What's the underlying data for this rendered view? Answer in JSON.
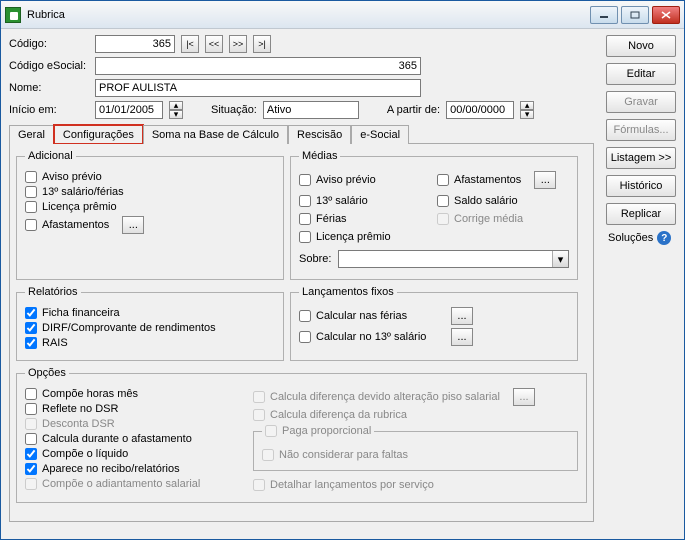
{
  "window": {
    "title": "Rubrica"
  },
  "buttons": {
    "novo": "Novo",
    "editar": "Editar",
    "gravar": "Gravar",
    "formulas": "Fórmulas...",
    "listagem": "Listagem >>",
    "historico": "Histórico",
    "replicar": "Replicar",
    "solucoes": "Soluções"
  },
  "form": {
    "codigo_label": "Código:",
    "codigo": "365",
    "codigo_esocial_label": "Código eSocial:",
    "codigo_esocial": "365",
    "nome_label": "Nome:",
    "nome": "PROF AULISTA",
    "inicio_label": "Início em:",
    "inicio": "01/01/2005",
    "situacao_label": "Situação:",
    "situacao": "Ativo",
    "apartir_label": "A partir de:",
    "apartir": "00/00/0000"
  },
  "tabs": {
    "geral": "Geral",
    "config": "Configurações",
    "soma": "Soma na Base de Cálculo",
    "rescisao": "Rescisão",
    "esocial": "e-Social"
  },
  "nav": {
    "first": "|<",
    "prev": "<<",
    "next": ">>",
    "last": ">|",
    "ellipsis": "...",
    "down": "▾",
    "up": "▴"
  },
  "adicional": {
    "legend": "Adicional",
    "aviso": "Aviso prévio",
    "decimo": "13º salário/férias",
    "licenca": "Licença prêmio",
    "afast": "Afastamentos"
  },
  "medias": {
    "legend": "Médias",
    "aviso": "Aviso prévio",
    "afast": "Afastamentos",
    "decimo": "13º salário",
    "saldo": "Saldo salário",
    "ferias": "Férias",
    "corrige": "Corrige média",
    "licenca": "Licença prêmio",
    "sobre": "Sobre:"
  },
  "relatorios": {
    "legend": "Relatórios",
    "ficha": "Ficha financeira",
    "dirf": "DIRF/Comprovante de rendimentos",
    "rais": "RAIS"
  },
  "lanc": {
    "legend": "Lançamentos fixos",
    "ferias": "Calcular nas férias",
    "decimo": "Calcular no 13º salário"
  },
  "opcoes": {
    "legend": "Opções",
    "horas": "Compõe horas mês",
    "reflete": "Reflete no DSR",
    "desconta": "Desconta DSR",
    "afast": "Calcula durante o afastamento",
    "liquido": "Compõe o líquido",
    "recibo": "Aparece no recibo/relatórios",
    "adiant": "Compõe o adiantamento salarial",
    "difpiso": "Calcula diferença devido alteração piso salarial",
    "difrub": "Calcula diferença da rubrica",
    "paga_legend": "Paga proporcional",
    "faltas": "Não considerar para faltas",
    "detalhar": "Detalhar lançamentos por serviço"
  }
}
